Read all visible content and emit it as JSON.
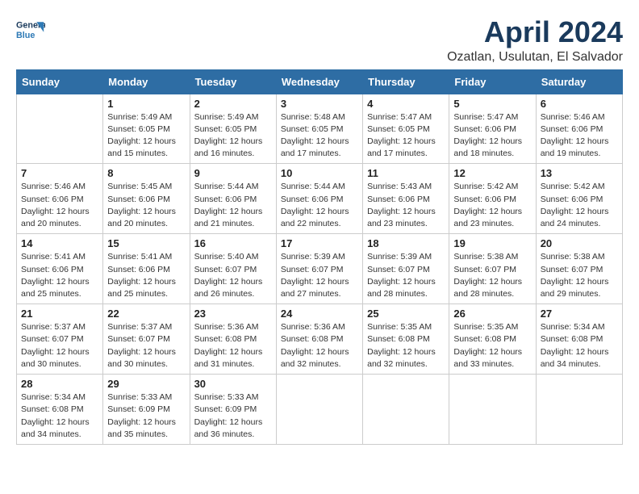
{
  "logo": {
    "line1": "General",
    "line2": "Blue"
  },
  "title": "April 2024",
  "subtitle": "Ozatlan, Usulutan, El Salvador",
  "weekdays": [
    "Sunday",
    "Monday",
    "Tuesday",
    "Wednesday",
    "Thursday",
    "Friday",
    "Saturday"
  ],
  "weeks": [
    [
      {
        "day": "",
        "info": ""
      },
      {
        "day": "1",
        "info": "Sunrise: 5:49 AM\nSunset: 6:05 PM\nDaylight: 12 hours\nand 15 minutes."
      },
      {
        "day": "2",
        "info": "Sunrise: 5:49 AM\nSunset: 6:05 PM\nDaylight: 12 hours\nand 16 minutes."
      },
      {
        "day": "3",
        "info": "Sunrise: 5:48 AM\nSunset: 6:05 PM\nDaylight: 12 hours\nand 17 minutes."
      },
      {
        "day": "4",
        "info": "Sunrise: 5:47 AM\nSunset: 6:05 PM\nDaylight: 12 hours\nand 17 minutes."
      },
      {
        "day": "5",
        "info": "Sunrise: 5:47 AM\nSunset: 6:06 PM\nDaylight: 12 hours\nand 18 minutes."
      },
      {
        "day": "6",
        "info": "Sunrise: 5:46 AM\nSunset: 6:06 PM\nDaylight: 12 hours\nand 19 minutes."
      }
    ],
    [
      {
        "day": "7",
        "info": "Sunrise: 5:46 AM\nSunset: 6:06 PM\nDaylight: 12 hours\nand 20 minutes."
      },
      {
        "day": "8",
        "info": "Sunrise: 5:45 AM\nSunset: 6:06 PM\nDaylight: 12 hours\nand 20 minutes."
      },
      {
        "day": "9",
        "info": "Sunrise: 5:44 AM\nSunset: 6:06 PM\nDaylight: 12 hours\nand 21 minutes."
      },
      {
        "day": "10",
        "info": "Sunrise: 5:44 AM\nSunset: 6:06 PM\nDaylight: 12 hours\nand 22 minutes."
      },
      {
        "day": "11",
        "info": "Sunrise: 5:43 AM\nSunset: 6:06 PM\nDaylight: 12 hours\nand 23 minutes."
      },
      {
        "day": "12",
        "info": "Sunrise: 5:42 AM\nSunset: 6:06 PM\nDaylight: 12 hours\nand 23 minutes."
      },
      {
        "day": "13",
        "info": "Sunrise: 5:42 AM\nSunset: 6:06 PM\nDaylight: 12 hours\nand 24 minutes."
      }
    ],
    [
      {
        "day": "14",
        "info": "Sunrise: 5:41 AM\nSunset: 6:06 PM\nDaylight: 12 hours\nand 25 minutes."
      },
      {
        "day": "15",
        "info": "Sunrise: 5:41 AM\nSunset: 6:06 PM\nDaylight: 12 hours\nand 25 minutes."
      },
      {
        "day": "16",
        "info": "Sunrise: 5:40 AM\nSunset: 6:07 PM\nDaylight: 12 hours\nand 26 minutes."
      },
      {
        "day": "17",
        "info": "Sunrise: 5:39 AM\nSunset: 6:07 PM\nDaylight: 12 hours\nand 27 minutes."
      },
      {
        "day": "18",
        "info": "Sunrise: 5:39 AM\nSunset: 6:07 PM\nDaylight: 12 hours\nand 28 minutes."
      },
      {
        "day": "19",
        "info": "Sunrise: 5:38 AM\nSunset: 6:07 PM\nDaylight: 12 hours\nand 28 minutes."
      },
      {
        "day": "20",
        "info": "Sunrise: 5:38 AM\nSunset: 6:07 PM\nDaylight: 12 hours\nand 29 minutes."
      }
    ],
    [
      {
        "day": "21",
        "info": "Sunrise: 5:37 AM\nSunset: 6:07 PM\nDaylight: 12 hours\nand 30 minutes."
      },
      {
        "day": "22",
        "info": "Sunrise: 5:37 AM\nSunset: 6:07 PM\nDaylight: 12 hours\nand 30 minutes."
      },
      {
        "day": "23",
        "info": "Sunrise: 5:36 AM\nSunset: 6:08 PM\nDaylight: 12 hours\nand 31 minutes."
      },
      {
        "day": "24",
        "info": "Sunrise: 5:36 AM\nSunset: 6:08 PM\nDaylight: 12 hours\nand 32 minutes."
      },
      {
        "day": "25",
        "info": "Sunrise: 5:35 AM\nSunset: 6:08 PM\nDaylight: 12 hours\nand 32 minutes."
      },
      {
        "day": "26",
        "info": "Sunrise: 5:35 AM\nSunset: 6:08 PM\nDaylight: 12 hours\nand 33 minutes."
      },
      {
        "day": "27",
        "info": "Sunrise: 5:34 AM\nSunset: 6:08 PM\nDaylight: 12 hours\nand 34 minutes."
      }
    ],
    [
      {
        "day": "28",
        "info": "Sunrise: 5:34 AM\nSunset: 6:08 PM\nDaylight: 12 hours\nand 34 minutes."
      },
      {
        "day": "29",
        "info": "Sunrise: 5:33 AM\nSunset: 6:09 PM\nDaylight: 12 hours\nand 35 minutes."
      },
      {
        "day": "30",
        "info": "Sunrise: 5:33 AM\nSunset: 6:09 PM\nDaylight: 12 hours\nand 36 minutes."
      },
      {
        "day": "",
        "info": ""
      },
      {
        "day": "",
        "info": ""
      },
      {
        "day": "",
        "info": ""
      },
      {
        "day": "",
        "info": ""
      }
    ]
  ]
}
